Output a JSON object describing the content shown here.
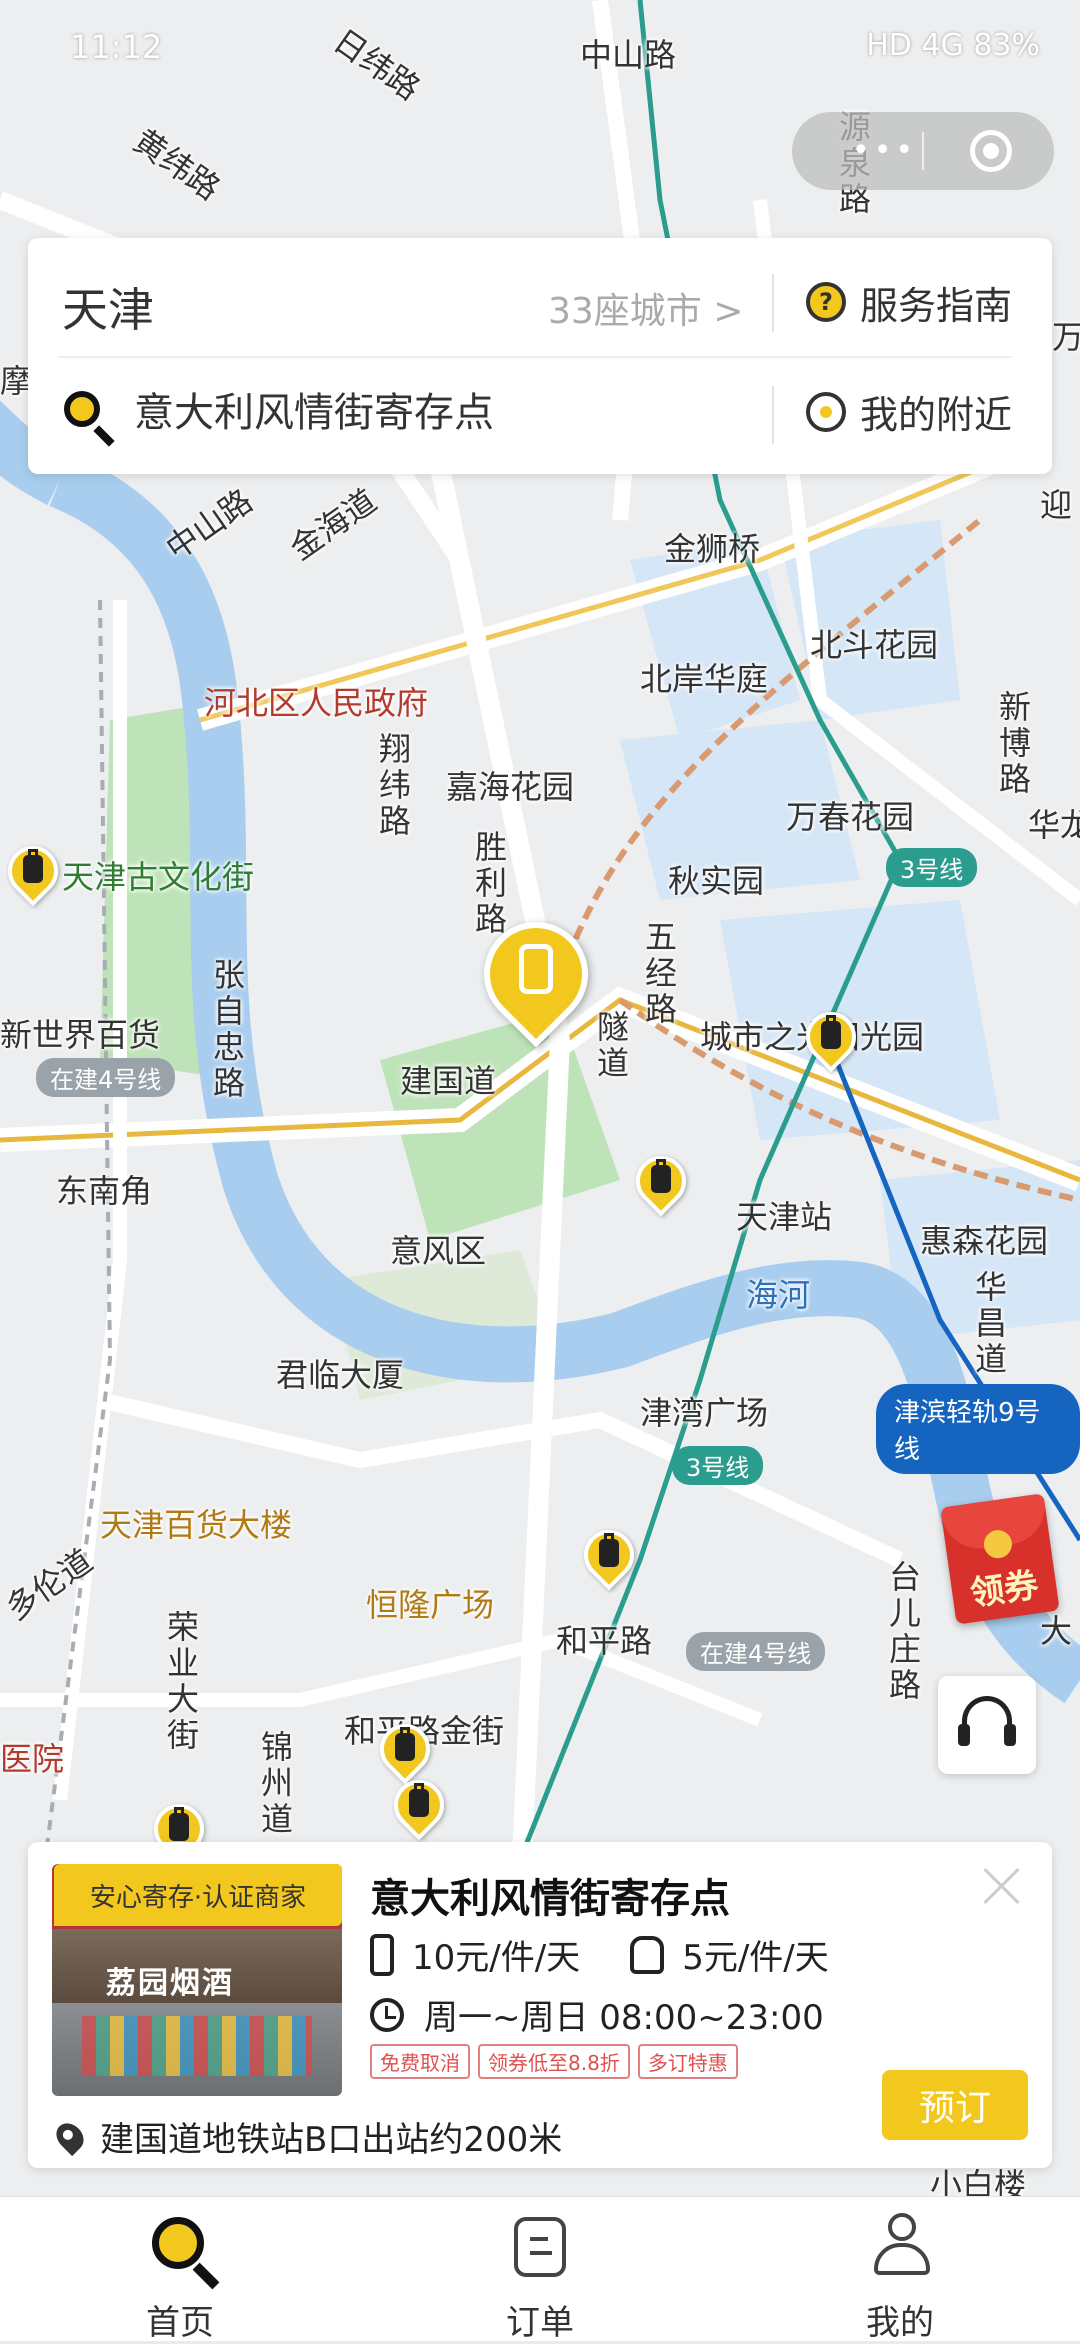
{
  "status_bar": {
    "time": "11:12",
    "right": "HD 4G 83%"
  },
  "header": {
    "city": "天津",
    "city_count": "33座城市 >",
    "guide_label": "服务指南",
    "search_value": "意大利风情街寄存点",
    "nearby_label": "我的附近"
  },
  "map": {
    "labels": {
      "zhongshan_top": "中山路",
      "riwei": "日纬路",
      "huangwei": "黄纬路",
      "yuanquan": "源泉路",
      "jinshiqiao": "金狮桥",
      "beidouhuayuan": "北斗花园",
      "beianhuating": "北岸华庭",
      "hebei_gov": "河北区人民政府",
      "jiahai": "嘉海花园",
      "wanchun": "万春花园",
      "qiushi": "秋实园",
      "guwenhua": "天津古文化街",
      "xinshijie": "新世界百货",
      "jianguodao": "建国道",
      "chengshizhiguang": "城市之光阳光园",
      "dongnanjiao": "东南角",
      "yifengqu": "意风区",
      "tianjinzhan": "天津站",
      "huisen": "惠森花园",
      "haihe": "海河",
      "junlin": "君临大厦",
      "jinwan": "津湾广场",
      "baihuo": "天津百货大楼",
      "henglong": "恒隆广场",
      "hepinglu": "和平路",
      "jinjie": "和平路金街",
      "xinbo": "新博路",
      "hualong": "华龙",
      "ying": "迎",
      "zhangzizhong": "张自忠路",
      "xiangwei": "翔纬路",
      "shengli": "胜利路",
      "wujing": "五经路",
      "suidao": "隧道",
      "jinhai": "金海道",
      "zhongshan": "中山路",
      "duolun": "多伦道",
      "rongye": "荣业大街",
      "jinzhou": "锦州道",
      "huachang": "华昌道",
      "taierzhuang": "台儿庄路",
      "yiyuan": "医院",
      "xiaorilou": "小白楼",
      "mo": "摩",
      "da": "大",
      "wanfang": "万"
    },
    "line_badges": {
      "line3_a": "3号线",
      "line3_b": "3号线",
      "line4_a": "在建4号线",
      "line4_b": "在建4号线",
      "line9": "津滨轻轨9号线"
    }
  },
  "side": {
    "coupon_label": "领券"
  },
  "store": {
    "trust_badge": "安心寄存·认证商家",
    "photo_sign": "荔园烟酒",
    "name": "意大利风情街寄存点",
    "price_luggage": "10元/件/天",
    "price_bag": "5元/件/天",
    "hours": "周一~周日 08:00~23:00",
    "tags": [
      "免费取消",
      "领券低至8.8折",
      "多订特惠"
    ],
    "book_label": "预订",
    "address": "建国道地铁站B口出站约200米"
  },
  "tabbar": {
    "home": "首页",
    "orders": "订单",
    "me": "我的"
  },
  "colors": {
    "accent": "#f2c81e",
    "metro3": "#2a9d8f",
    "line9": "#1565c0"
  }
}
